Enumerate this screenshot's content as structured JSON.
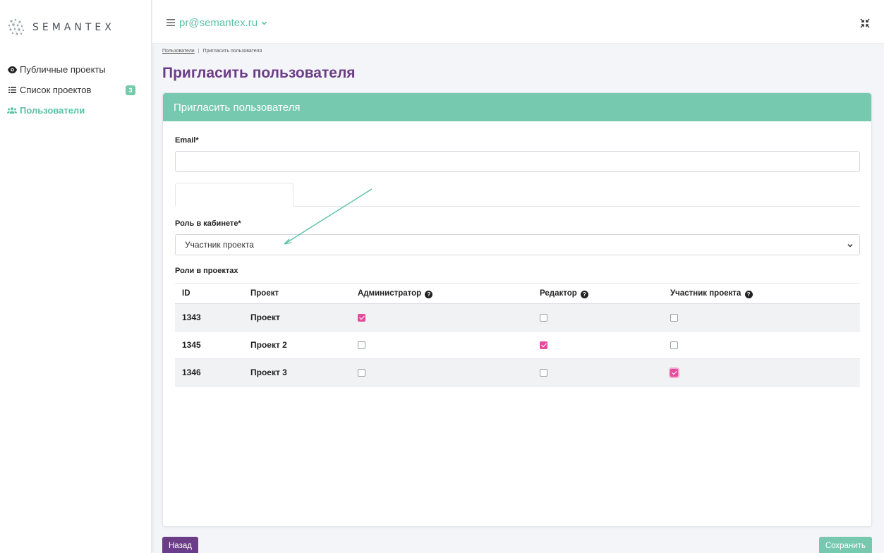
{
  "brand": {
    "name": "SEMANTEX"
  },
  "sidebar": {
    "items": [
      {
        "label": "Публичные проекты",
        "icon": "eye-icon"
      },
      {
        "label": "Список проектов",
        "icon": "list-icon",
        "badge": "3"
      },
      {
        "label": "Пользователи",
        "icon": "users-icon",
        "active": true
      }
    ]
  },
  "topbar": {
    "account": "pr@semantex.ru"
  },
  "breadcrumb": {
    "parent": "Пользователи",
    "current": "Пригласить пользователя"
  },
  "page": {
    "title": "Пригласить пользователя"
  },
  "card": {
    "header": "Пригласить пользователя",
    "email_label": "Email*",
    "email_value": "",
    "role_label": "Роль в кабинете*",
    "role_value": "Участник проекта",
    "project_roles_label": "Роли в проектах"
  },
  "table": {
    "columns": [
      "ID",
      "Проект",
      "Администратор",
      "Редактор",
      "Участник проекта"
    ],
    "rows": [
      {
        "id": "1343",
        "project": "Проект",
        "admin": true,
        "editor": false,
        "member": false
      },
      {
        "id": "1345",
        "project": "Проект 2",
        "admin": false,
        "editor": true,
        "member": false
      },
      {
        "id": "1346",
        "project": "Проект 3",
        "admin": false,
        "editor": false,
        "member": true
      }
    ]
  },
  "buttons": {
    "back": "Назад",
    "save": "Сохранить"
  },
  "colors": {
    "accent_green": "#76c9ae",
    "purple": "#6b3d86",
    "checkbox_pink": "#e44b9c"
  }
}
